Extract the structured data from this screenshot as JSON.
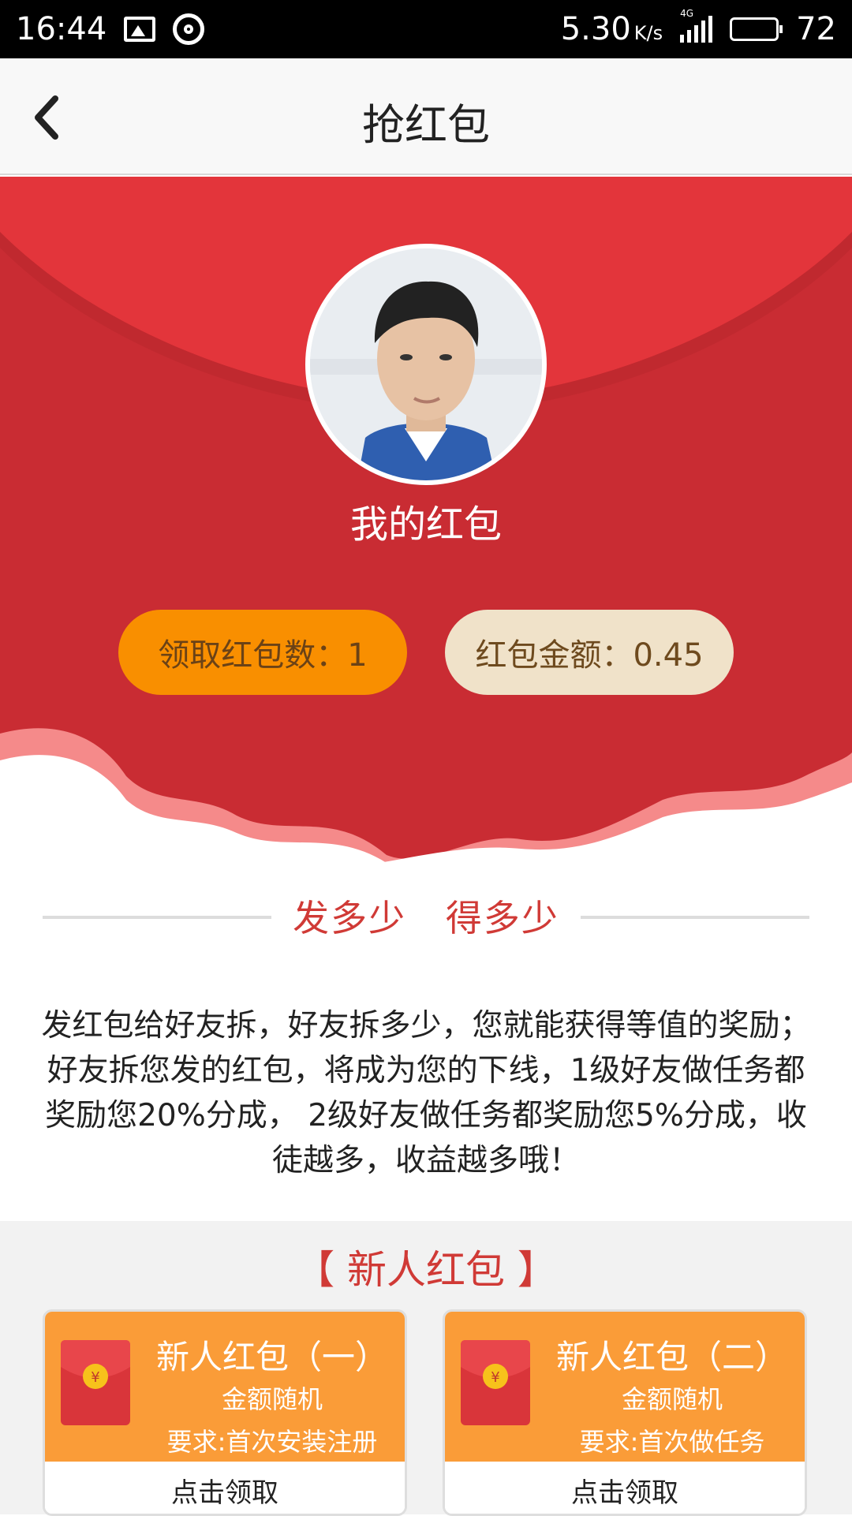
{
  "status_bar": {
    "time": "16:44",
    "net_speed": "5.30",
    "net_unit": "K/s",
    "network_type": "4G",
    "battery": "72"
  },
  "nav": {
    "title": "抢红包",
    "back_icon": "chevron-left-icon"
  },
  "banner": {
    "title": "我的红包",
    "count_label": "领取红包数：1",
    "amount_label": "红包金额：0.45",
    "colors": {
      "red": "#e3353b",
      "dark_red": "#c92c33",
      "pink_wave": "#f58a8a"
    }
  },
  "promo": {
    "heading": "发多少   得多少",
    "description": "发红包给好友拆，好友拆多少，您就能获得等值的奖励； 好友拆您发的红包，将成为您的下线，1级好友做任务都奖励您20%分成， 2级好友做任务都奖励您5%分成，收徒越多，收益越多哦！"
  },
  "new_user": {
    "title": "【 新人红包 】",
    "cards": [
      {
        "name": "新人红包（一）",
        "sub": "金额随机",
        "requirement": "要求:首次安装注册",
        "action": "点击领取"
      },
      {
        "name": "新人红包（二）",
        "sub": "金额随机",
        "requirement": "要求:首次做任务",
        "action": "点击领取"
      }
    ],
    "envelope_symbol": "¥"
  }
}
